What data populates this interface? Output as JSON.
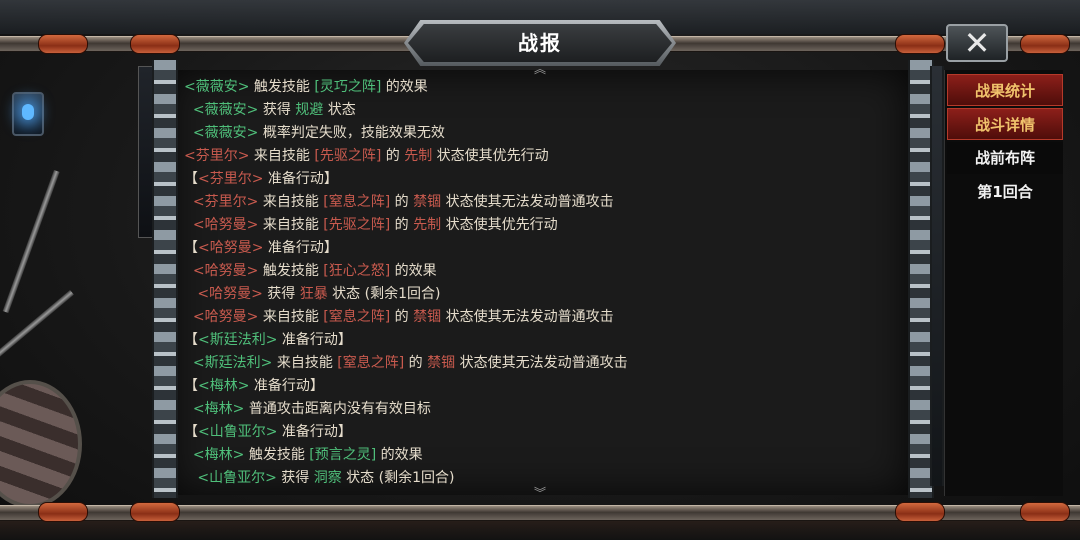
{
  "title": "战报",
  "close_label": "✕",
  "scroll": {
    "up": "︽",
    "down": "︾"
  },
  "menu": [
    {
      "label": "战果统计"
    },
    {
      "label": "战斗详情"
    },
    {
      "label": "战前布阵"
    },
    {
      "label": "第1回合"
    }
  ],
  "colors": {
    "hero_green": "#4fbf7a",
    "enemy_red": "#c85a4e",
    "text": "#e5dccb",
    "tab_gold": "#f0c36c"
  },
  "log": [
    [
      {
        "c": "g",
        "t": "<薇薇安>"
      },
      {
        "c": "w",
        "t": " 触发技能 "
      },
      {
        "c": "g",
        "t": "[灵巧之阵]"
      },
      {
        "c": "w",
        "t": " 的效果"
      }
    ],
    [
      {
        "c": "w",
        "t": "  "
      },
      {
        "c": "g",
        "t": "<薇薇安>"
      },
      {
        "c": "w",
        "t": " 获得 "
      },
      {
        "c": "g",
        "t": "规避"
      },
      {
        "c": "w",
        "t": " 状态"
      }
    ],
    [
      {
        "c": "w",
        "t": "  "
      },
      {
        "c": "g",
        "t": "<薇薇安>"
      },
      {
        "c": "w",
        "t": " 概率判定失败，技能效果无效"
      }
    ],
    [
      {
        "c": "r",
        "t": "<芬里尔>"
      },
      {
        "c": "w",
        "t": " 来自技能 "
      },
      {
        "c": "r",
        "t": "[先驱之阵]"
      },
      {
        "c": "w",
        "t": " 的 "
      },
      {
        "c": "r",
        "t": "先制"
      },
      {
        "c": "w",
        "t": " 状态使其优先行动"
      }
    ],
    [
      {
        "c": "w",
        "t": "【"
      },
      {
        "c": "r",
        "t": "<芬里尔>"
      },
      {
        "c": "w",
        "t": " 准备行动】"
      }
    ],
    [
      {
        "c": "w",
        "t": "  "
      },
      {
        "c": "r",
        "t": "<芬里尔>"
      },
      {
        "c": "w",
        "t": " 来自技能 "
      },
      {
        "c": "r",
        "t": "[窒息之阵]"
      },
      {
        "c": "w",
        "t": " 的 "
      },
      {
        "c": "r",
        "t": "禁锢"
      },
      {
        "c": "w",
        "t": " 状态使其无法发动普通攻击"
      }
    ],
    [
      {
        "c": "w",
        "t": "  "
      },
      {
        "c": "r",
        "t": "<哈努曼>"
      },
      {
        "c": "w",
        "t": " 来自技能 "
      },
      {
        "c": "r",
        "t": "[先驱之阵]"
      },
      {
        "c": "w",
        "t": " 的 "
      },
      {
        "c": "r",
        "t": "先制"
      },
      {
        "c": "w",
        "t": " 状态使其优先行动"
      }
    ],
    [
      {
        "c": "w",
        "t": "【"
      },
      {
        "c": "r",
        "t": "<哈努曼>"
      },
      {
        "c": "w",
        "t": " 准备行动】"
      }
    ],
    [
      {
        "c": "w",
        "t": "  "
      },
      {
        "c": "r",
        "t": "<哈努曼>"
      },
      {
        "c": "w",
        "t": " 触发技能 "
      },
      {
        "c": "r",
        "t": "[狂心之怒]"
      },
      {
        "c": "w",
        "t": " 的效果"
      }
    ],
    [
      {
        "c": "w",
        "t": "   "
      },
      {
        "c": "r",
        "t": "<哈努曼>"
      },
      {
        "c": "w",
        "t": " 获得 "
      },
      {
        "c": "r",
        "t": "狂暴"
      },
      {
        "c": "w",
        "t": " 状态 (剩余1回合)"
      }
    ],
    [
      {
        "c": "w",
        "t": "  "
      },
      {
        "c": "r",
        "t": "<哈努曼>"
      },
      {
        "c": "w",
        "t": " 来自技能 "
      },
      {
        "c": "r",
        "t": "[窒息之阵]"
      },
      {
        "c": "w",
        "t": " 的 "
      },
      {
        "c": "r",
        "t": "禁锢"
      },
      {
        "c": "w",
        "t": " 状态使其无法发动普通攻击"
      }
    ],
    [
      {
        "c": "w",
        "t": "【"
      },
      {
        "c": "g",
        "t": "<斯廷法利>"
      },
      {
        "c": "w",
        "t": " 准备行动】"
      }
    ],
    [
      {
        "c": "w",
        "t": "  "
      },
      {
        "c": "g",
        "t": "<斯廷法利>"
      },
      {
        "c": "w",
        "t": " 来自技能 "
      },
      {
        "c": "r",
        "t": "[窒息之阵]"
      },
      {
        "c": "w",
        "t": " 的 "
      },
      {
        "c": "r",
        "t": "禁锢"
      },
      {
        "c": "w",
        "t": " 状态使其无法发动普通攻击"
      }
    ],
    [
      {
        "c": "w",
        "t": "【"
      },
      {
        "c": "g",
        "t": "<梅林>"
      },
      {
        "c": "w",
        "t": " 准备行动】"
      }
    ],
    [
      {
        "c": "w",
        "t": "  "
      },
      {
        "c": "g",
        "t": "<梅林>"
      },
      {
        "c": "w",
        "t": " 普通攻击距离内没有有效目标"
      }
    ],
    [
      {
        "c": "w",
        "t": "【"
      },
      {
        "c": "g",
        "t": "<山鲁亚尔>"
      },
      {
        "c": "w",
        "t": " 准备行动】"
      }
    ],
    [
      {
        "c": "w",
        "t": "  "
      },
      {
        "c": "g",
        "t": "<梅林>"
      },
      {
        "c": "w",
        "t": " 触发技能 "
      },
      {
        "c": "g",
        "t": "[预言之灵]"
      },
      {
        "c": "w",
        "t": " 的效果"
      }
    ],
    [
      {
        "c": "w",
        "t": "   "
      },
      {
        "c": "g",
        "t": "<山鲁亚尔>"
      },
      {
        "c": "w",
        "t": " 获得 "
      },
      {
        "c": "g",
        "t": "洞察"
      },
      {
        "c": "w",
        "t": " 状态 (剩余1回合)"
      }
    ]
  ]
}
